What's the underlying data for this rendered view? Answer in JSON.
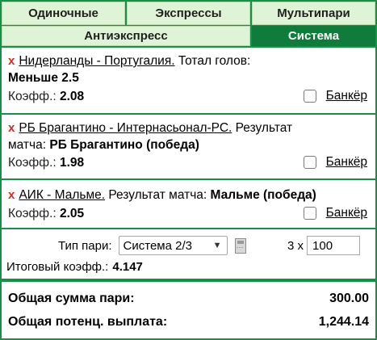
{
  "tabs": {
    "singles": "Одиночные",
    "express": "Экспрессы",
    "multi": "Мультипари",
    "antiexpress": "Антиэкспресс",
    "system": "Система"
  },
  "bets": [
    {
      "event": "Нидерланды - Португалия.",
      "market": "Тотал голов:",
      "selection": "Меньше 2.5",
      "coef_label": "Коэфф.:",
      "coef": "2.08",
      "banker": "Банкёр"
    },
    {
      "event": "РБ Брагантино - Интернасьонал-РС.",
      "market": "Результат",
      "market_cont": "матча:",
      "selection": "РБ Брагантино (победа)",
      "coef_label": "Коэфф.:",
      "coef": "1.98",
      "banker": "Банкёр"
    },
    {
      "event": "АИК - Мальме.",
      "market": "Результат матча:",
      "selection": "Мальме (победа)",
      "coef_label": "Коэфф.:",
      "coef": "2.05",
      "banker": "Банкёр"
    }
  ],
  "remove_glyph": "x",
  "system": {
    "bet_type_label": "Тип пари:",
    "bet_type_value": "Система 2/3",
    "multiplier": "3 x",
    "amount": "100",
    "total_coef_label": "Итоговый коэфф.:",
    "total_coef": "4.147"
  },
  "totals": {
    "stake_label": "Общая сумма пари:",
    "stake": "300.00",
    "payout_label": "Общая потенц. выплата:",
    "payout": "1,244.14"
  },
  "colors": {
    "frame": "#168f47",
    "tab_active": "#0f7c3b",
    "tab_inactive": "#dff4d6",
    "remove": "#d42a1e"
  }
}
